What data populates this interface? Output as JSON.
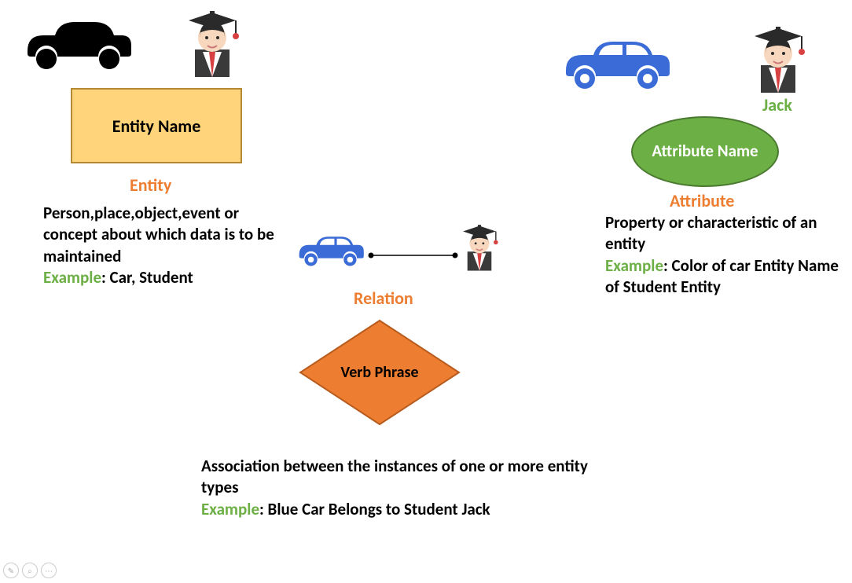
{
  "entity": {
    "box_label": "Entity Name",
    "title": "Entity",
    "description": "Person,place,object,event or concept about which data is to be maintained",
    "example_label": "Example",
    "example_text": ": Car, Student"
  },
  "attribute": {
    "oval_label": "Attribute Name",
    "title": "Attribute",
    "description": "Property or characteristic of an entity",
    "example_label": "Example",
    "example_text": ": Color of car Entity Name of Student Entity",
    "jack_label": "Jack"
  },
  "relation": {
    "diamond_label": "Verb Phrase",
    "title": "Relation",
    "description": "Association between the instances of one or more entity types",
    "example_label": "Example",
    "example_text": ": Blue Car Belongs to Student Jack"
  }
}
